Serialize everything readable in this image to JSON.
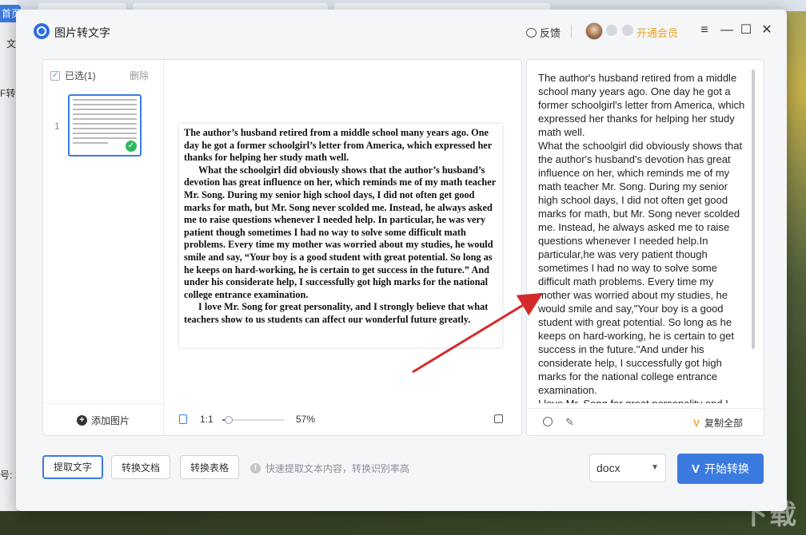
{
  "background": {
    "home_tab": "首页",
    "side_text_1": "文",
    "side_text_2": "F转",
    "side_text_3": "号: 1",
    "watermark": "下载"
  },
  "window": {
    "title": "图片转文字",
    "feedback": "反馈",
    "vip_link": "开通会员",
    "controls": [
      "≡",
      "—",
      "☐",
      "✕"
    ]
  },
  "thumbs": {
    "selected": "已选(1)",
    "delete": "删除",
    "page_number": "1",
    "add_image": "添加图片"
  },
  "preview": {
    "paragraphs": [
      "The author’s husband retired from a middle school many years ago. One day he got a former schoolgirl’s letter from America, which expressed her thanks for helping her study math well.",
      "What the schoolgirl did obviously shows that the author’s husband’s devotion has great influence on her, which reminds me of my math teacher Mr. Song. During my senior high school days, I did not often get good marks for math, but Mr. Song never scolded me. Instead, he always asked me to raise questions whenever I needed help. In particular, he was very patient though sometimes I had no way to solve some difficult math problems. Every time my mother was worried about my studies, he would smile and say, “Your boy is a good student with great potential. So long as he keeps on hard-working, he is certain to get success in the future.” And under his considerate help, I successfully got high marks for the national college entrance examination.",
      "I love Mr. Song for great personality, and I strongly believe that what teachers show to us students can affect our wonderful future greatly."
    ],
    "ratio_label": "1:1",
    "zoom_level": 57,
    "zoom_label": "57%"
  },
  "result": {
    "paragraphs": [
      "The author's husband retired from a middle school many years ago. One day he got a former schoolgirl's letter from America, which expressed her thanks for helping her study math well.",
      "What the schoolgirl did obviously shows that the author's husband's devotion has great influence on her, which reminds me of my math teacher Mr. Song. During my senior high school days, I did not often get good marks for math, but Mr. Song never scolded me. Instead, he always asked me to raise questions whenever I needed help.In particular,he was very patient though sometimes I had no way to solve some difficult math problems. Every time my mother was worried about my studies, he would smile and say,\"Your boy is a good student with great potential. So long as he keeps on hard-working, he is certain to get success in the future.\"And under his considerate help, I successfully got high marks for the national college entrance examination.",
      "I love Mr. Song for great personality and I strongly believe that what teachers show to us students can affect our wonderful future greatly."
    ],
    "copy_all": "复制全部",
    "vip_mark": "V"
  },
  "actions": {
    "extract_text": "提取文字",
    "convert_doc": "转换文档",
    "convert_table": "转换表格",
    "hint": "快速提取文本内容，转换识别率高",
    "format_value": "docx",
    "start_button": "开始转换",
    "start_mark": "V"
  },
  "colors": {
    "accent": "#3b7be0",
    "vip": "#e8a325",
    "annotation_arrow": "#d42a2a"
  }
}
